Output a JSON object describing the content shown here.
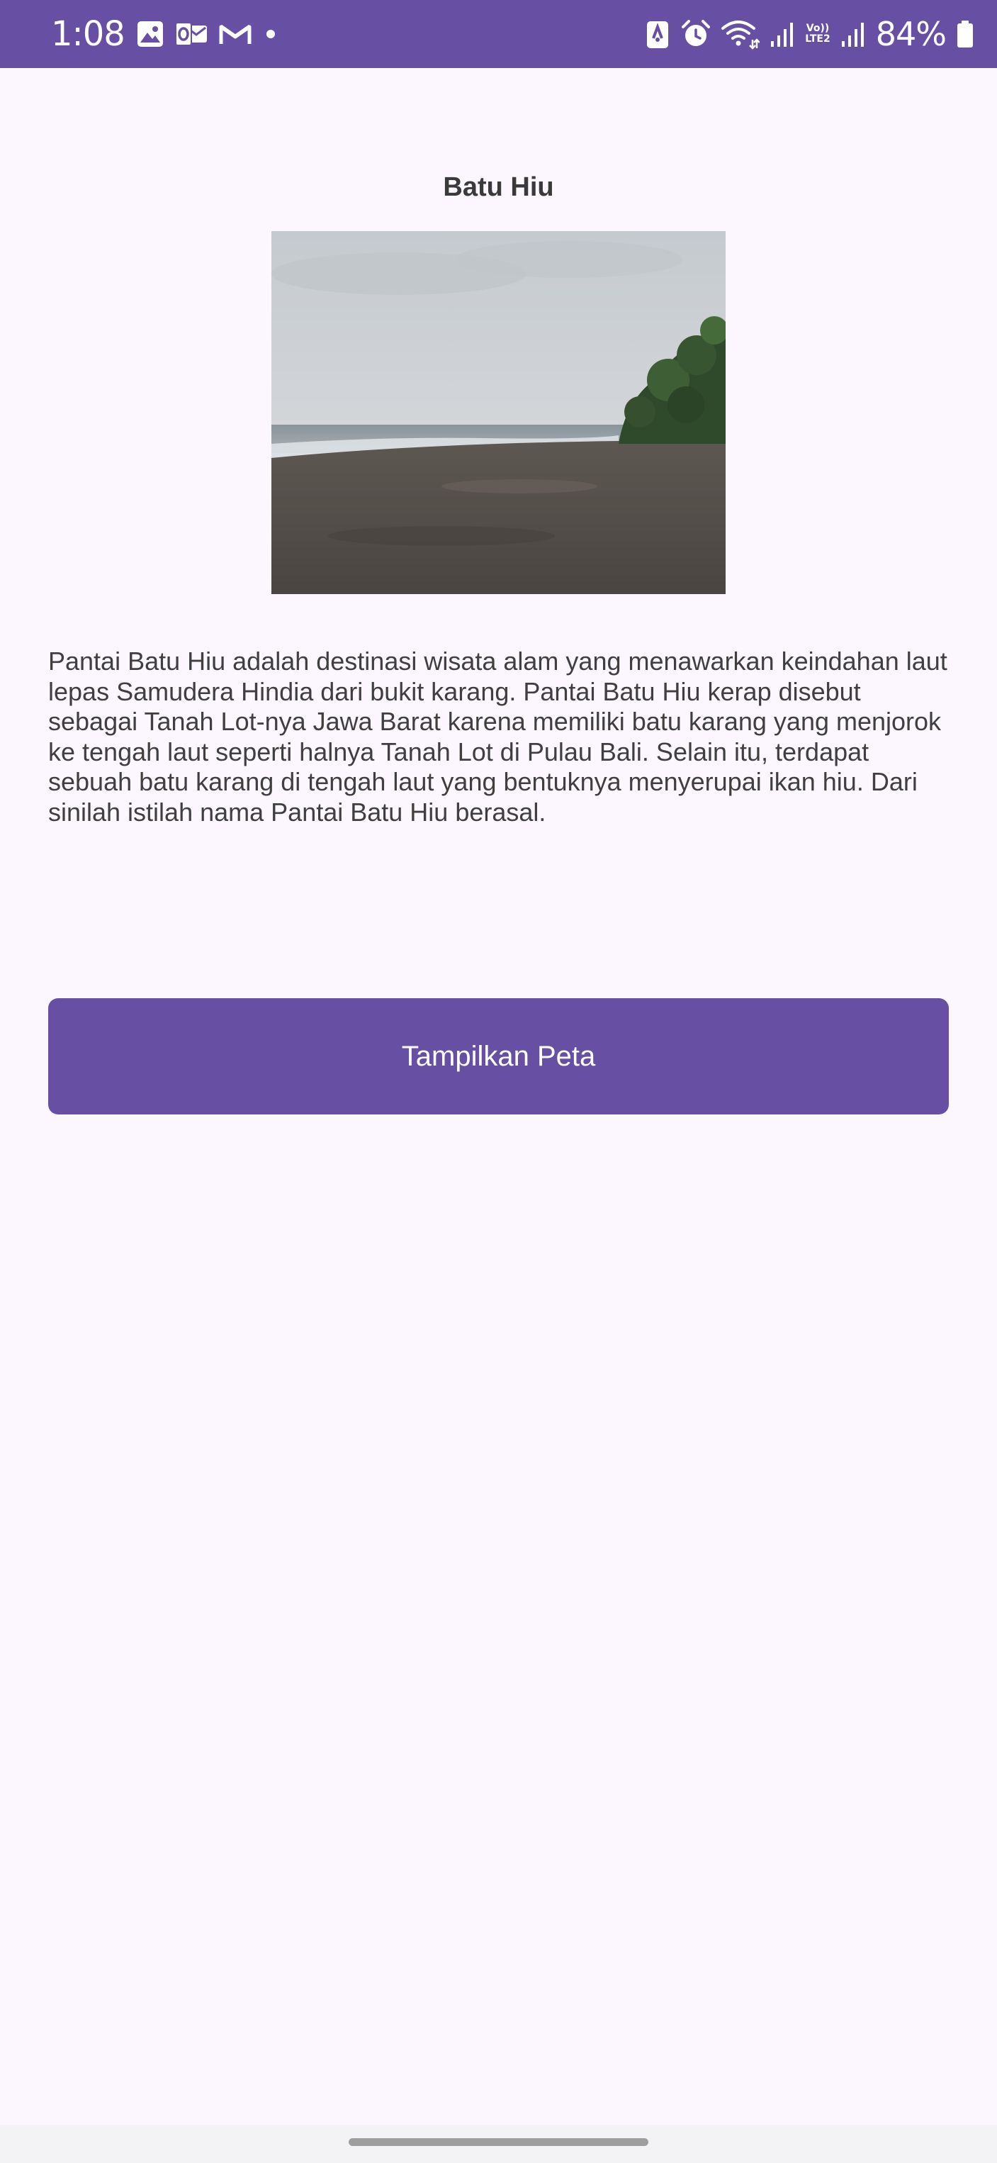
{
  "status_bar": {
    "time": "1:08",
    "battery": "84%",
    "volte_line1": "Vo))",
    "volte_line2": "LTE2",
    "icons_left": [
      "gallery-icon",
      "outlook-icon",
      "gmail-icon",
      "notification-dot-icon"
    ],
    "icons_right": [
      "nfc-lock-icon",
      "alarm-icon",
      "wifi-icon",
      "signal-icon",
      "signal-icon",
      "battery-icon"
    ]
  },
  "page": {
    "title": "Batu Hiu",
    "image_alt": "Batu Hiu",
    "description": "Pantai Batu Hiu adalah destinasi wisata alam yang menawarkan keindahan laut lepas Samudera Hindia dari bukit karang. Pantai Batu Hiu kerap disebut sebagai Tanah Lot-nya Jawa Barat karena memiliki batu karang yang menjorok ke tengah laut seperti halnya Tanah Lot di Pulau Bali. Selain itu, terdapat sebuah batu karang di tengah laut yang bentuknya menyerupai ikan hiu. Dari sinilah istilah nama Pantai Batu Hiu berasal.",
    "button_label": "Tampilkan Peta"
  },
  "colors": {
    "primary": "#674FA4",
    "background": "#FCF7FE",
    "on_primary": "#FFFFFF",
    "text": "#3F3F3F"
  }
}
